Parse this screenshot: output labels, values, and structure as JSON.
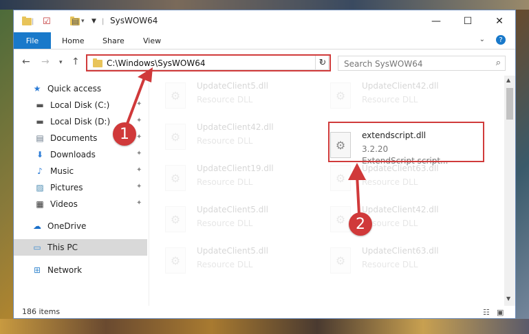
{
  "window": {
    "title": "SysWOW64",
    "controls": {
      "minimize": "—",
      "maximize": "☐",
      "close": "✕"
    }
  },
  "ribbon": {
    "file_tab": "File",
    "tabs": [
      "Home",
      "Share",
      "View"
    ]
  },
  "navigation": {
    "address": "C:\\Windows\\SysWOW64",
    "search_placeholder": "Search SysWOW64"
  },
  "sidebar": {
    "items": [
      {
        "label": "Quick access",
        "icon": "star-icon"
      },
      {
        "label": "Local Disk (C:)",
        "icon": "drive-icon"
      },
      {
        "label": "Local Disk (D:)",
        "icon": "drive-icon"
      },
      {
        "label": "Documents",
        "icon": "documents-icon"
      },
      {
        "label": "Downloads",
        "icon": "download-icon"
      },
      {
        "label": "Music",
        "icon": "music-icon"
      },
      {
        "label": "Pictures",
        "icon": "pictures-icon"
      },
      {
        "label": "Videos",
        "icon": "videos-icon"
      },
      {
        "label": "OneDrive",
        "icon": "cloud-icon"
      },
      {
        "label": "This PC",
        "icon": "computer-icon"
      },
      {
        "label": "Network",
        "icon": "network-icon"
      }
    ]
  },
  "files": {
    "left_column": [
      {
        "name": "UpdateClient5.dll",
        "type": "Resource DLL"
      },
      {
        "name": "UpdateClient42.dll",
        "type": "Resource DLL"
      },
      {
        "name": "UpdateClient19.dll",
        "type": "Resource DLL"
      },
      {
        "name": "UpdateClient5.dll",
        "type": "Resource DLL"
      },
      {
        "name": "UpdateClient5.dll",
        "type": "Resource DLL"
      }
    ],
    "right_column": [
      {
        "name": "UpdateClient42.dll",
        "type": "Resource DLL"
      },
      {
        "name": "UpdateClient63.dll",
        "type": "Resource DLL"
      },
      {
        "name": "UpdateClient42.dll",
        "type": "Resource DLL"
      },
      {
        "name": "UpdateClient63.dll",
        "type": "Resource DLL"
      }
    ],
    "highlighted": {
      "name": "extendscript.dll",
      "version": "3.2.20",
      "description": "ExtendScript script..."
    }
  },
  "status": {
    "item_count": "186 items"
  },
  "annotations": {
    "step1": "1",
    "step2": "2",
    "color": "#d0393a"
  }
}
